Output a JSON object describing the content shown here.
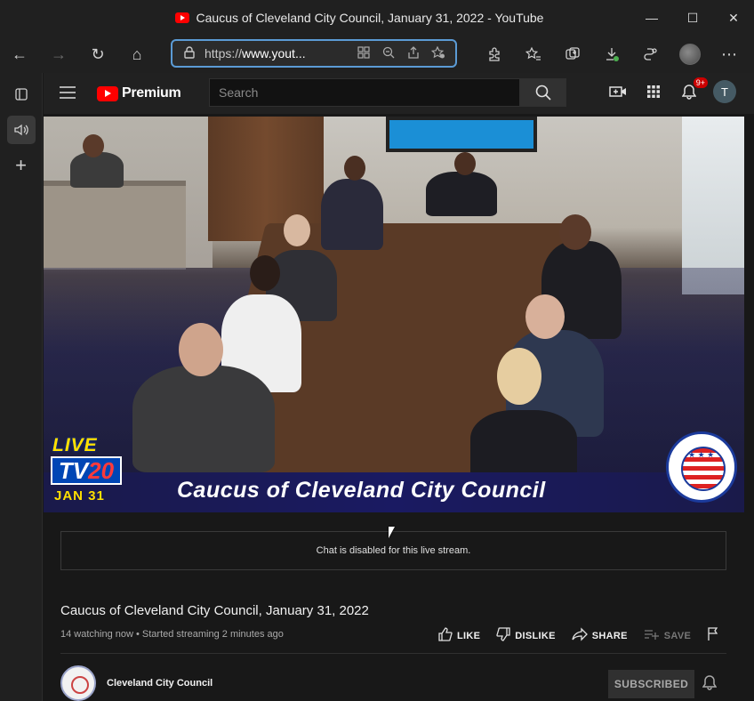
{
  "window": {
    "title": "Caucus of Cleveland City Council, January 31, 2022 - YouTube",
    "minimize": "—",
    "maximize": "☐",
    "close": "✕"
  },
  "browser": {
    "back": "←",
    "forward": "→",
    "refresh": "↻",
    "home": "⌂",
    "url_prefix": "https://",
    "url_host": "www.yout...",
    "lock": "🔒",
    "more": "⋯"
  },
  "sidebar": {
    "tabs_icon": "▣",
    "audio_icon": "🔊",
    "add_icon": "+"
  },
  "youtube": {
    "logo_text": "Premium",
    "search_placeholder": "Search",
    "notification_count": "9+",
    "avatar_letter": "T"
  },
  "video": {
    "banner_text": "Caucus of Cleveland City Council",
    "live": "LIVE",
    "tv_prefix": "TV",
    "tv_number": "20",
    "date": "JAN 31"
  },
  "chat": {
    "message": "Chat is disabled for this live stream."
  },
  "details": {
    "title": "Caucus of Cleveland City Council, January 31, 2022",
    "meta": "14 watching now • Started streaming 2 minutes ago",
    "like": "LIKE",
    "dislike": "DISLIKE",
    "share": "SHARE",
    "save": "SAVE"
  },
  "channel": {
    "name": "Cleveland City Council",
    "subscribed_label": "SUBSCRIBED"
  },
  "colors": {
    "accent": "#5b9bd5",
    "youtube_red": "#ff0000",
    "banner_blue": "#1a1a62"
  }
}
